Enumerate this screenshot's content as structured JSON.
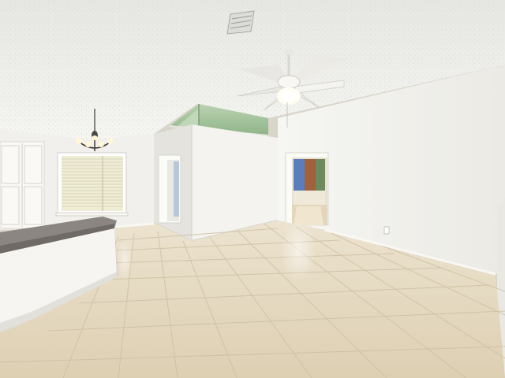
{
  "photo": {
    "scene": "empty-interior-room",
    "features": [
      "textured-ceiling",
      "ceiling-vent",
      "ceiling-fan",
      "chandelier",
      "pantry-cabinet",
      "window-with-blinds",
      "kitchen-counter",
      "hallway-door",
      "doorway-to-next-room",
      "outlet",
      "tile-floor"
    ]
  },
  "colors": {
    "ceiling": "#eeeeeb",
    "wall_light": "#f3f2ee",
    "wall_shade": "#e2e1dc",
    "floor": "#e8dcc4",
    "floor_shade": "#d8c9ab",
    "grout": "#cdbfa3",
    "counter_top": "#8b8682",
    "skylight_glass": "#a6c6a0",
    "curtain": "#a0623c",
    "window_glass": "#f0edd6"
  }
}
